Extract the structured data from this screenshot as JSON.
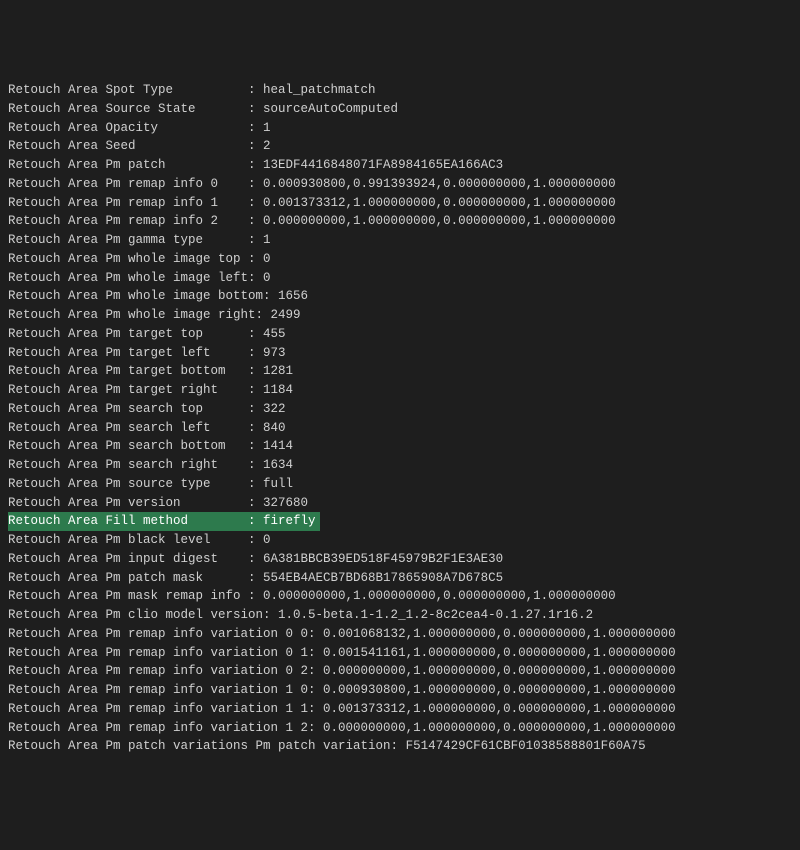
{
  "lines": [
    {
      "label": "Retouch Area Spot Type          ",
      "sep": ": ",
      "value": "heal_patchmatch",
      "highlighted": false
    },
    {
      "label": "Retouch Area Source State       ",
      "sep": ": ",
      "value": "sourceAutoComputed",
      "highlighted": false
    },
    {
      "label": "Retouch Area Opacity            ",
      "sep": ": ",
      "value": "1",
      "highlighted": false
    },
    {
      "label": "Retouch Area Seed               ",
      "sep": ": ",
      "value": "2",
      "highlighted": false
    },
    {
      "label": "Retouch Area Pm patch           ",
      "sep": ": ",
      "value": "13EDF4416848071FA8984165EA166AC3",
      "highlighted": false
    },
    {
      "label": "Retouch Area Pm remap info 0    ",
      "sep": ": ",
      "value": "0.000930800,0.991393924,0.000000000,1.000000000",
      "highlighted": false
    },
    {
      "label": "Retouch Area Pm remap info 1    ",
      "sep": ": ",
      "value": "0.001373312,1.000000000,0.000000000,1.000000000",
      "highlighted": false
    },
    {
      "label": "Retouch Area Pm remap info 2    ",
      "sep": ": ",
      "value": "0.000000000,1.000000000,0.000000000,1.000000000",
      "highlighted": false
    },
    {
      "label": "Retouch Area Pm gamma type      ",
      "sep": ": ",
      "value": "1",
      "highlighted": false
    },
    {
      "label": "Retouch Area Pm whole image top ",
      "sep": ": ",
      "value": "0",
      "highlighted": false
    },
    {
      "label": "Retouch Area Pm whole image left",
      "sep": ": ",
      "value": "0",
      "highlighted": false
    },
    {
      "label": "Retouch Area Pm whole image bottom",
      "sep": ": ",
      "value": "1656",
      "highlighted": false
    },
    {
      "label": "Retouch Area Pm whole image right",
      "sep": ": ",
      "value": "2499",
      "highlighted": false
    },
    {
      "label": "Retouch Area Pm target top      ",
      "sep": ": ",
      "value": "455",
      "highlighted": false
    },
    {
      "label": "Retouch Area Pm target left     ",
      "sep": ": ",
      "value": "973",
      "highlighted": false
    },
    {
      "label": "Retouch Area Pm target bottom   ",
      "sep": ": ",
      "value": "1281",
      "highlighted": false
    },
    {
      "label": "Retouch Area Pm target right    ",
      "sep": ": ",
      "value": "1184",
      "highlighted": false
    },
    {
      "label": "Retouch Area Pm search top      ",
      "sep": ": ",
      "value": "322",
      "highlighted": false
    },
    {
      "label": "Retouch Area Pm search left     ",
      "sep": ": ",
      "value": "840",
      "highlighted": false
    },
    {
      "label": "Retouch Area Pm search bottom   ",
      "sep": ": ",
      "value": "1414",
      "highlighted": false
    },
    {
      "label": "Retouch Area Pm search right    ",
      "sep": ": ",
      "value": "1634",
      "highlighted": false
    },
    {
      "label": "Retouch Area Pm source type     ",
      "sep": ": ",
      "value": "full",
      "highlighted": false
    },
    {
      "label": "Retouch Area Pm version         ",
      "sep": ": ",
      "value": "327680",
      "highlighted": false
    },
    {
      "label": "Retouch Area Fill method        ",
      "sep": ": ",
      "value": "firefly",
      "highlighted": true
    },
    {
      "label": "Retouch Area Pm black level     ",
      "sep": ": ",
      "value": "0",
      "highlighted": false
    },
    {
      "label": "Retouch Area Pm input digest    ",
      "sep": ": ",
      "value": "6A381BBCB39ED518F45979B2F1E3AE30",
      "highlighted": false
    },
    {
      "label": "Retouch Area Pm patch mask      ",
      "sep": ": ",
      "value": "554EB4AECB7BD68B17865908A7D678C5",
      "highlighted": false
    },
    {
      "label": "Retouch Area Pm mask remap info ",
      "sep": ": ",
      "value": "0.000000000,1.000000000,0.000000000,1.000000000",
      "highlighted": false
    },
    {
      "label": "Retouch Area Pm clio model version",
      "sep": ": ",
      "value": "1.0.5-beta.1-1.2_1.2-8c2cea4-0.1.27.1r16.2",
      "highlighted": false
    },
    {
      "label": "Retouch Area Pm remap info variation 0 0",
      "sep": ": ",
      "value": "0.001068132,1.000000000,0.000000000,1.000000000",
      "highlighted": false
    },
    {
      "label": "Retouch Area Pm remap info variation 0 1",
      "sep": ": ",
      "value": "0.001541161,1.000000000,0.000000000,1.000000000",
      "highlighted": false
    },
    {
      "label": "Retouch Area Pm remap info variation 0 2",
      "sep": ": ",
      "value": "0.000000000,1.000000000,0.000000000,1.000000000",
      "highlighted": false
    },
    {
      "label": "Retouch Area Pm remap info variation 1 0",
      "sep": ": ",
      "value": "0.000930800,1.000000000,0.000000000,1.000000000",
      "highlighted": false
    },
    {
      "label": "Retouch Area Pm remap info variation 1 1",
      "sep": ": ",
      "value": "0.001373312,1.000000000,0.000000000,1.000000000",
      "highlighted": false
    },
    {
      "label": "Retouch Area Pm remap info variation 1 2",
      "sep": ": ",
      "value": "0.000000000,1.000000000,0.000000000,1.000000000",
      "highlighted": false
    },
    {
      "label": "Retouch Area Pm patch variations Pm patch variation",
      "sep": ": ",
      "value": "F5147429CF61CBF01038588801F60A75",
      "highlighted": false
    }
  ]
}
